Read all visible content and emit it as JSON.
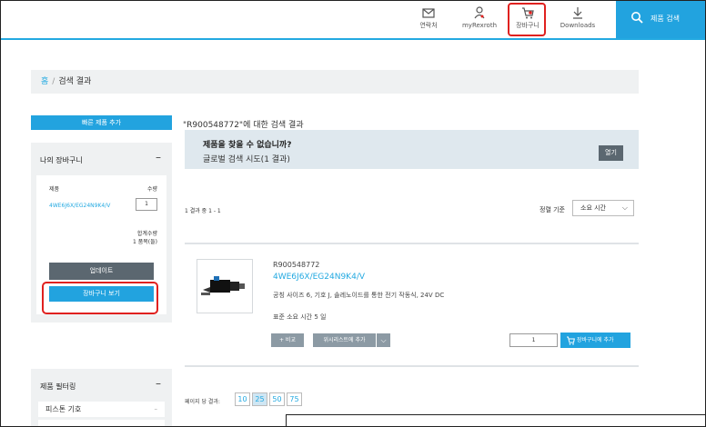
{
  "header": {
    "nav": [
      {
        "label": "연락처",
        "icon": "envelope-icon"
      },
      {
        "label": "myRexroth",
        "icon": "user-icon"
      },
      {
        "label": "장바구니",
        "icon": "cart-icon"
      },
      {
        "label": "Downloads",
        "icon": "download-icon"
      }
    ],
    "search_label": "제품 검색"
  },
  "breadcrumb": {
    "home": "홈",
    "separator": "/",
    "current": "검색 결과"
  },
  "sidebar": {
    "quick_add_label": "빠른 제품 추가",
    "cart": {
      "title": "나의 장바구니",
      "collapse": "–",
      "col_product": "제품",
      "col_qty": "수량",
      "item_name": "4WE6J6X/EG24N9K4/V",
      "item_qty": "1",
      "total_label": "합계수량",
      "total_value": "1 품목(들)",
      "update_label": "업데이트",
      "view_cart_label": "장바구니 보기"
    },
    "filter": {
      "title": "제품 필터링",
      "collapse": "–",
      "item": "피스톤 기호",
      "item_toggle": "–"
    }
  },
  "main": {
    "results_for": "\"R900548772\"에 대한 검색 결과",
    "not_found_title": "제품을 찾을 수 없습니까?",
    "not_found_sub": "글로벌 검색 시도(1 결과)",
    "open_label": "열기",
    "count": "1 결과 중 1 - 1",
    "sort_label": "정렬 기준",
    "sort_value": "소요 시간",
    "product": {
      "code": "R900548772",
      "name": "4WE6J6X/EG24N9K4/V",
      "desc": "공칭 사이즈 6, 기호 J, 솔레노이드를 통한 전기 작동식, 24V DC",
      "lead": "표준 소요 시간 5 일",
      "compare_label": "+ 비교",
      "wishlist_label": "위시리스트에 추가",
      "qty": "1",
      "add_cart_label": "장바구니에 추가"
    },
    "per_page_label": "페이지 당 결과:",
    "per_page": [
      "10",
      "25",
      "50",
      "75"
    ],
    "per_page_selected": "25"
  },
  "colors": {
    "accent": "#22a3df",
    "highlight": "#e0211f",
    "panel": "#eff1f2",
    "dark_button": "#5b6770"
  }
}
